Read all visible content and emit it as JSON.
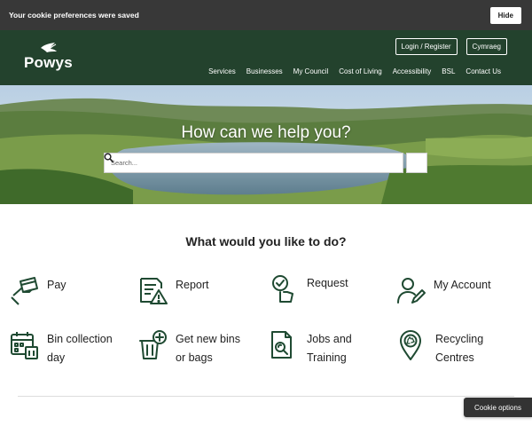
{
  "cookie_banner": {
    "message": "Your cookie preferences were saved",
    "hide_label": "Hide"
  },
  "header": {
    "logo_text": "Powys",
    "login_label": "Login / Register",
    "language_label": "Cymraeg",
    "nav": [
      "Services",
      "Businesses",
      "My Council",
      "Cost of Living",
      "Accessibility",
      "BSL",
      "Contact Us"
    ]
  },
  "hero": {
    "title": "How can we help you?",
    "search_placeholder": "Search..."
  },
  "tasks_section": {
    "title": "What would you like to do?",
    "items": [
      {
        "label": "Pay",
        "icon": "card-payment-icon"
      },
      {
        "label": "Report",
        "icon": "report-warning-icon"
      },
      {
        "label": "Request",
        "icon": "request-hand-icon"
      },
      {
        "label": "My Account",
        "icon": "user-edit-icon"
      },
      {
        "label": "Bin collection day",
        "line1": "Bin collection",
        "line2": "day",
        "icon": "calendar-bin-icon"
      },
      {
        "label": "Get new bins or bags",
        "line1": "Get new bins",
        "line2": "or bags",
        "icon": "bin-add-icon"
      },
      {
        "label": "Jobs and Training",
        "line1": "Jobs and",
        "line2": "Training",
        "icon": "document-search-icon"
      },
      {
        "label": "Recycling Centres",
        "line1": "Recycling",
        "line2": "Centres",
        "icon": "recycling-pin-icon"
      }
    ]
  },
  "cookie_options_label": "Cookie options",
  "colors": {
    "header_green": "#23422d",
    "cookie_bar": "#383838",
    "icon_green": "#1f4a32"
  }
}
